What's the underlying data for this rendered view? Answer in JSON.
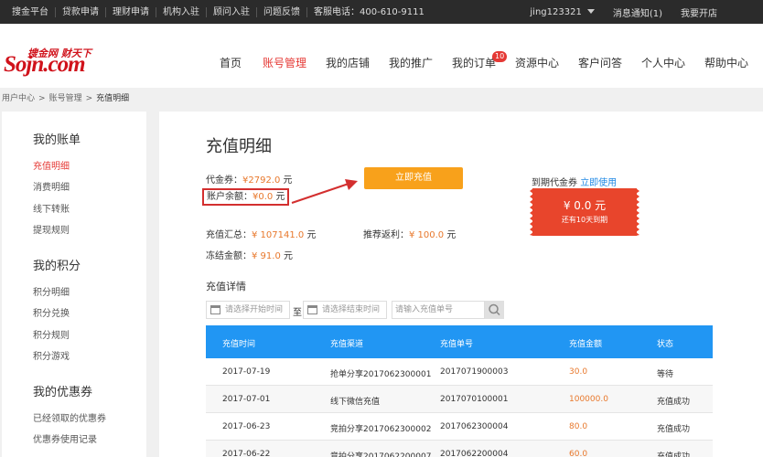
{
  "topbar": {
    "links": [
      "搜金平台",
      "贷款申请",
      "理财申请",
      "机构入驻",
      "顾问入驻",
      "问题反馈",
      "客服电话：400-610-9111"
    ],
    "username": "jing123321",
    "notice": "消息通知(1)",
    "open_store": "我要开店"
  },
  "logo": {
    "slogan": "搜金网 财天下",
    "brand": "Sojn.com"
  },
  "nav": {
    "items": [
      "首页",
      "账号管理",
      "我的店铺",
      "我的推广",
      "我的订单",
      "资源中心",
      "客户问答",
      "个人中心",
      "帮助中心"
    ],
    "order_badge": "10"
  },
  "breadcrumb": {
    "root": "用户中心",
    "sep": ">",
    "level1": "账号管理",
    "current": "充值明细"
  },
  "sidebar": {
    "groups": [
      {
        "title": "我的账单",
        "items": [
          "充值明细",
          "消费明细",
          "线下转账",
          "提现规则"
        ]
      },
      {
        "title": "我的积分",
        "items": [
          "积分明细",
          "积分兑换",
          "积分规则",
          "积分游戏"
        ]
      },
      {
        "title": "我的优惠券",
        "items": [
          "已经领取的优惠券",
          "优惠券使用记录"
        ]
      }
    ]
  },
  "main": {
    "title": "充值明细",
    "voucher_label": "代金券：",
    "voucher_value": "¥2792.0",
    "voucher_unit": " 元",
    "balance_label": "账户余额：",
    "balance_value": "¥0.0",
    "balance_unit": " 元",
    "recharge_button": "立即充值",
    "total_label": "充值汇总：",
    "total_value": "¥ 107141.0",
    "total_unit": " 元",
    "rebate_label": "推荐返利：",
    "rebate_value": "¥ 100.0",
    "rebate_unit": " 元",
    "frozen_label": "冻结金额：",
    "frozen_value": "¥ 91.0",
    "frozen_unit": " 元",
    "expire_label": "到期代金券 ",
    "expire_link": "立即使用",
    "coupon_amount": "¥ 0.0 元",
    "coupon_remaining": "还有10天到期"
  },
  "details": {
    "title": "充值详情",
    "start_placeholder": "请选择开始时间",
    "to": "至",
    "end_placeholder": "请选择结束时间",
    "order_placeholder": "请输入充值单号",
    "columns": [
      "充值时间",
      "充值渠道",
      "充值单号",
      "充值金额",
      "状态"
    ],
    "rows": [
      [
        "2017-07-19",
        "抢单分享2017062300001",
        "2017071900003",
        "30.0",
        "等待"
      ],
      [
        "2017-07-01",
        "线下微信充值",
        "2017070100001",
        "100000.0",
        "充值成功"
      ],
      [
        "2017-06-23",
        "竞拍分享2017062300002",
        "2017062300004",
        "80.0",
        "充值成功"
      ],
      [
        "2017-06-22",
        "竞拍分享2017062200007",
        "2017062200004",
        "60.0",
        "充值成功"
      ]
    ]
  },
  "colors": {
    "accent": "#e53935",
    "orange": "#f8a11b",
    "blue": "#2196f3",
    "coupon": "#e8452c"
  }
}
